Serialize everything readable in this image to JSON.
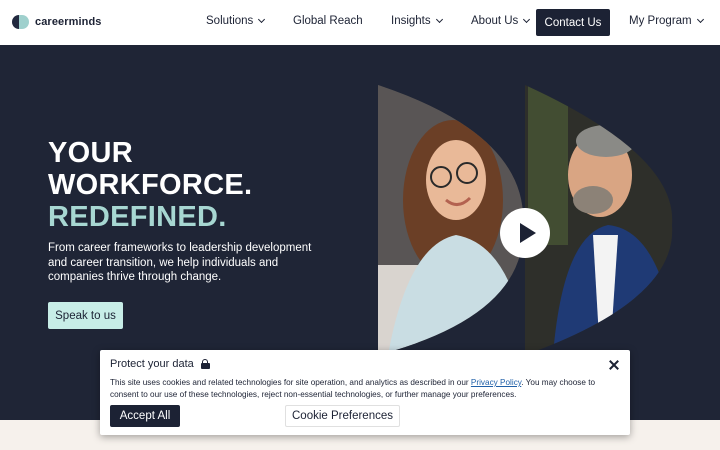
{
  "brand": {
    "name": "careerminds",
    "colors": {
      "navy": "#1c2234",
      "teal": "#a7d7d2",
      "mint": "#c7ede7",
      "hero_bg": "#1f2536"
    }
  },
  "nav": {
    "items": [
      {
        "label": "Solutions",
        "has_dropdown": true
      },
      {
        "label": "Global Reach",
        "has_dropdown": false
      },
      {
        "label": "Insights",
        "has_dropdown": true
      },
      {
        "label": "About Us",
        "has_dropdown": true
      }
    ],
    "cta": "Contact Us",
    "program": {
      "label": "My Program",
      "has_dropdown": true
    }
  },
  "hero": {
    "headline_line1": "YOUR",
    "headline_line2": "WORKFORCE.",
    "headline_line3": "REDEFINED.",
    "description": "From career frameworks to leadership development and career transition, we help individuals and companies thrive through change.",
    "cta": "Speak to us",
    "video_icon": "play-icon"
  },
  "cookie": {
    "title": "Protect your data",
    "title_icon": "lock-icon",
    "text_before": "This site uses cookies and related technologies for site operation, and analytics as described in our ",
    "link": "Privacy Policy",
    "text_after": ". You may choose to consent to our use of these technologies, reject non-essential technologies, or further manage your preferences.",
    "accept": "Accept All",
    "preferences": "Cookie Preferences",
    "close_icon": "close-icon"
  }
}
